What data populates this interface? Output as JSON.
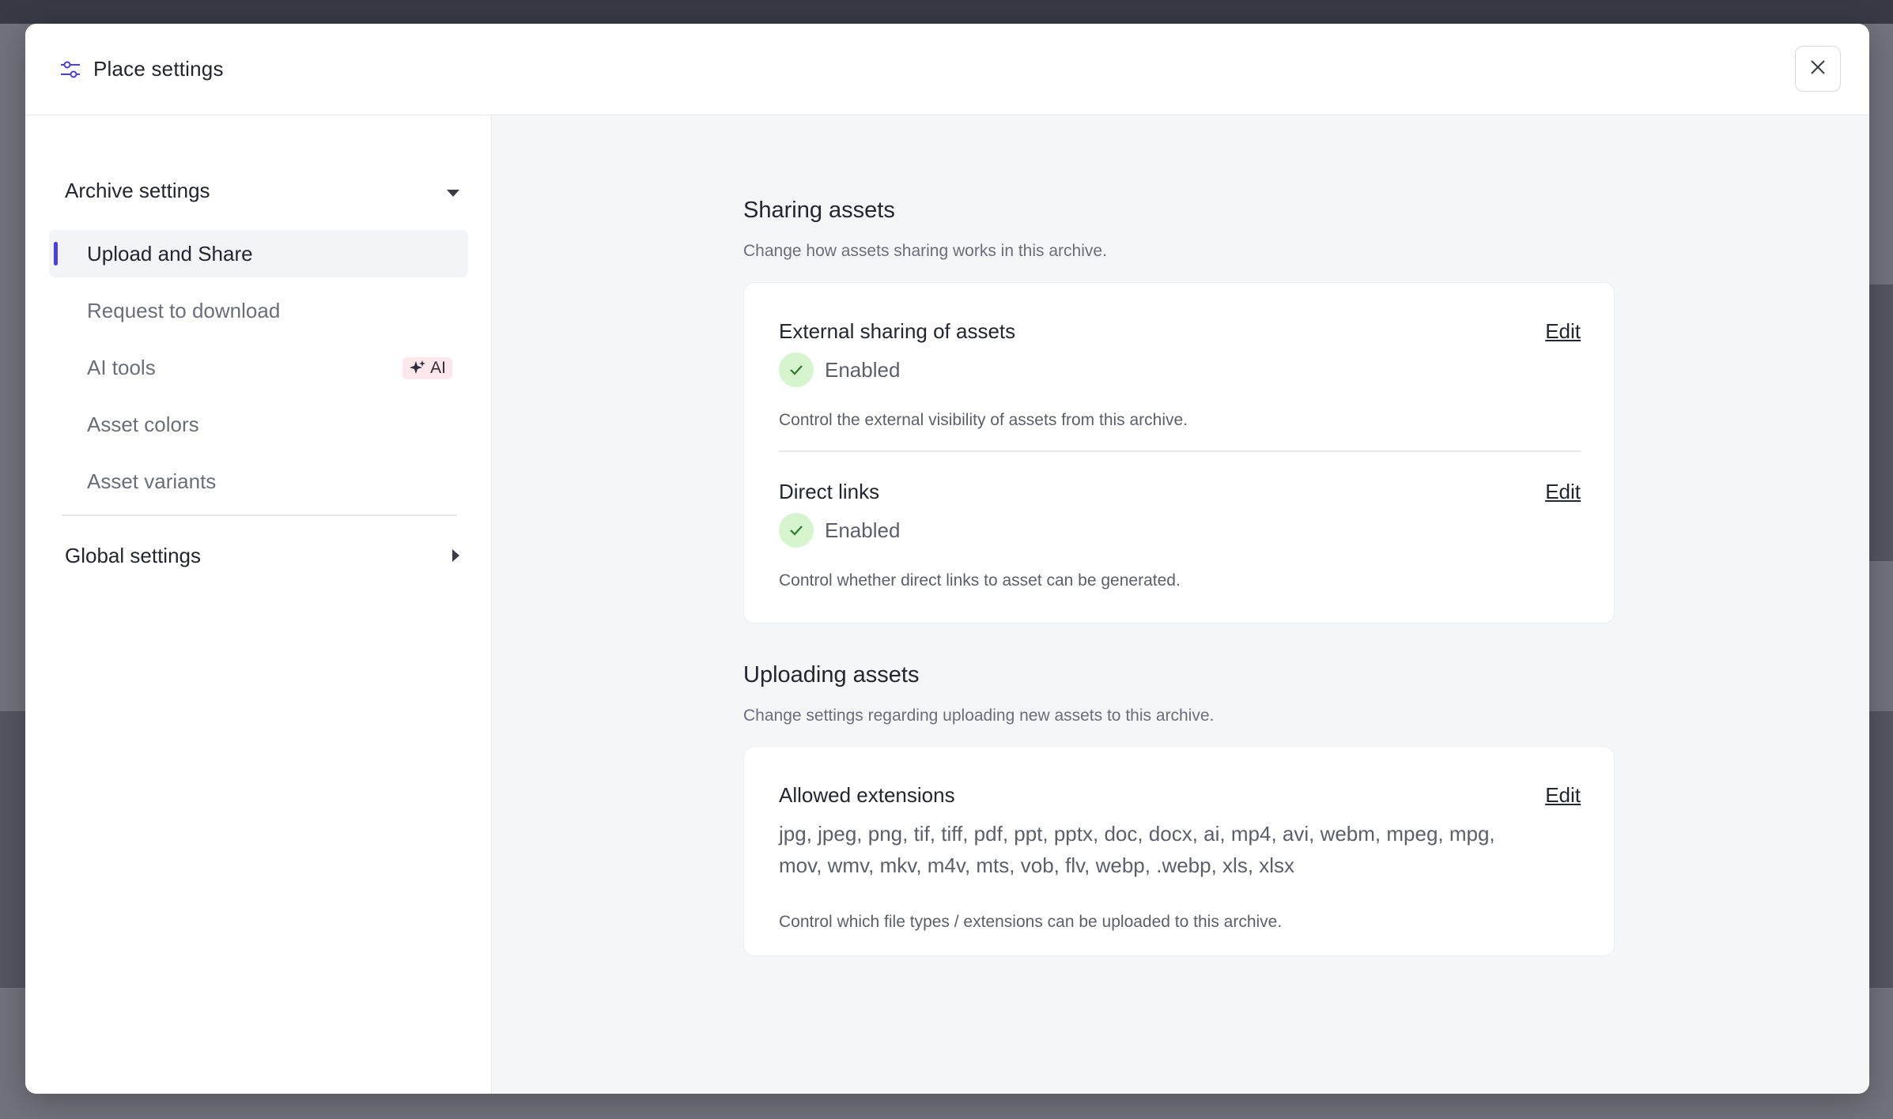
{
  "modal": {
    "title": "Place settings",
    "icon": "sliders-icon",
    "close_icon": "close-icon"
  },
  "sidebar": {
    "archive_section": "Archive settings",
    "items": [
      {
        "label": "Upload and Share",
        "active": true
      },
      {
        "label": "Request to download",
        "active": false
      },
      {
        "label": "AI tools",
        "active": false,
        "badge": "AI"
      },
      {
        "label": "Asset colors",
        "active": false
      },
      {
        "label": "Asset variants",
        "active": false
      }
    ],
    "global_section": "Global settings"
  },
  "sharing": {
    "title": "Sharing assets",
    "description": "Change how assets sharing works in this archive.",
    "settings": [
      {
        "title": "External sharing of assets",
        "edit": "Edit",
        "status": "Enabled",
        "description": "Control the external visibility of assets from this archive."
      },
      {
        "title": "Direct links",
        "edit": "Edit",
        "status": "Enabled",
        "description": "Control whether direct links to asset can be generated."
      }
    ]
  },
  "uploading": {
    "title": "Uploading assets",
    "description": "Change settings regarding uploading new assets to this archive.",
    "settings": [
      {
        "title": "Allowed extensions",
        "edit": "Edit",
        "value": "jpg, jpeg, png, tif, tiff, pdf, ppt, pptx, doc, docx, ai, mp4, avi, webm, mpeg, mpg, mov, wmv, mkv, m4v, mts, vob, flv, webp, .webp, xls, xlsx",
        "description": "Control which file types / extensions can be uploaded to this archive."
      }
    ]
  },
  "colors": {
    "accent": "#4a3fe0",
    "enabled_bg": "#d6f5cf",
    "enabled_check": "#2f7a2a",
    "ai_badge_bg": "#fbe7ec"
  }
}
